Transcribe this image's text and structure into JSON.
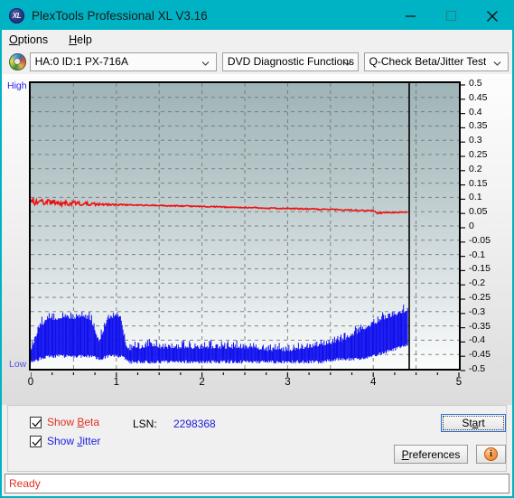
{
  "window": {
    "title": "PlexTools Professional XL V3.16",
    "icon": "XL",
    "app_icon_name": "plextools-logo-icon",
    "controls": {
      "minimize": "minimize-icon",
      "maximize": "maximize-icon",
      "close": "close-icon"
    },
    "titlebar_color": "#00b3c4"
  },
  "menu": {
    "items": [
      {
        "label": "Options",
        "accel": "O"
      },
      {
        "label": "Help",
        "accel": "H"
      }
    ]
  },
  "toolbar": {
    "disc_icon": "disc-icon",
    "drive_select": {
      "value": "HA:0 ID:1  PX-716A",
      "options": [
        "HA:0 ID:1  PX-716A"
      ]
    },
    "function_select": {
      "value": "DVD Diagnostic Functions",
      "options": [
        "DVD Diagnostic Functions"
      ]
    },
    "test_select": {
      "value": "Q-Check Beta/Jitter Test",
      "options": [
        "Q-Check Beta/Jitter Test"
      ]
    }
  },
  "chart_data": {
    "type": "line",
    "title": "Q-Check Beta/Jitter Test",
    "xlabel": "",
    "ylabel": "",
    "xlim": [
      0,
      5
    ],
    "ylim": [
      -0.5,
      0.5
    ],
    "grid": true,
    "legend_position": "bottom-left",
    "x_ticks": [
      "0",
      "1",
      "2",
      "3",
      "4",
      "5"
    ],
    "y_ticks": [
      "0.5",
      "0.45",
      "0.4",
      "0.35",
      "0.3",
      "0.25",
      "0.2",
      "0.15",
      "0.1",
      "0.05",
      "0",
      "-0.05",
      "-0.1",
      "-0.15",
      "-0.2",
      "-0.25",
      "-0.3",
      "-0.35",
      "-0.4",
      "-0.45",
      "-0.5"
    ],
    "axis_annotations": {
      "top_left": "High",
      "bottom_left": "Low"
    },
    "cursor_x": 4.42,
    "series": [
      {
        "name": "Beta",
        "color": "#ee1111",
        "x": [
          0.02,
          0.06,
          0.1,
          0.15,
          0.2,
          0.25,
          0.3,
          0.35,
          0.4,
          0.45,
          0.5,
          0.6,
          0.7,
          0.8,
          0.9,
          1.0,
          1.1,
          1.2,
          1.3,
          1.4,
          1.5,
          1.6,
          1.7,
          1.8,
          1.9,
          2.0,
          2.2,
          2.4,
          2.6,
          2.8,
          3.0,
          3.2,
          3.4,
          3.6,
          3.8,
          4.0,
          4.05,
          4.1,
          4.2,
          4.3,
          4.4
        ],
        "y": [
          0.088,
          0.083,
          0.087,
          0.081,
          0.086,
          0.08,
          0.084,
          0.079,
          0.082,
          0.078,
          0.08,
          0.078,
          0.077,
          0.076,
          0.075,
          0.074,
          0.074,
          0.073,
          0.073,
          0.072,
          0.072,
          0.071,
          0.07,
          0.07,
          0.069,
          0.068,
          0.067,
          0.065,
          0.064,
          0.062,
          0.061,
          0.06,
          0.058,
          0.057,
          0.055,
          0.053,
          0.044,
          0.046,
          0.047,
          0.048,
          0.048
        ],
        "noise_amplitude_start": 0.012,
        "noise_amplitude_end": 0.002
      },
      {
        "name": "Jitter",
        "color": "#1111ee",
        "x": [
          0.0,
          0.05,
          0.1,
          0.2,
          0.3,
          0.4,
          0.5,
          0.6,
          0.7,
          0.8,
          0.9,
          1.0,
          1.05,
          1.1,
          1.15,
          1.2,
          1.3,
          1.4,
          1.5,
          1.6,
          1.7,
          1.8,
          1.9,
          2.0,
          2.1,
          2.2,
          2.4,
          2.6,
          2.8,
          3.0,
          3.2,
          3.4,
          3.6,
          3.8,
          4.0,
          4.1,
          4.2,
          4.3,
          4.4
        ],
        "y_upper": [
          -0.44,
          -0.4,
          -0.36,
          -0.33,
          -0.33,
          -0.32,
          -0.33,
          -0.32,
          -0.33,
          -0.41,
          -0.33,
          -0.32,
          -0.32,
          -0.41,
          -0.44,
          -0.43,
          -0.43,
          -0.42,
          -0.43,
          -0.43,
          -0.43,
          -0.43,
          -0.43,
          -0.43,
          -0.43,
          -0.43,
          -0.43,
          -0.43,
          -0.44,
          -0.44,
          -0.43,
          -0.42,
          -0.41,
          -0.38,
          -0.35,
          -0.33,
          -0.32,
          -0.31,
          -0.3
        ],
        "y_lower": [
          -0.47,
          -0.47,
          -0.46,
          -0.45,
          -0.45,
          -0.45,
          -0.45,
          -0.45,
          -0.45,
          -0.46,
          -0.45,
          -0.45,
          -0.45,
          -0.46,
          -0.47,
          -0.47,
          -0.47,
          -0.47,
          -0.47,
          -0.47,
          -0.47,
          -0.47,
          -0.47,
          -0.47,
          -0.47,
          -0.47,
          -0.47,
          -0.47,
          -0.47,
          -0.47,
          -0.47,
          -0.47,
          -0.46,
          -0.46,
          -0.45,
          -0.44,
          -0.43,
          -0.42,
          -0.41
        ]
      }
    ]
  },
  "controls": {
    "show_beta": {
      "label_pre": "Show ",
      "accel": "B",
      "label_post": "eta",
      "checked": true
    },
    "show_jitter": {
      "label_pre": "Show ",
      "accel": "J",
      "label_post": "itter",
      "checked": true
    },
    "lsn_label": "LSN:",
    "lsn_value": "2298368",
    "start_button": {
      "label_pre": "St",
      "accel": "a",
      "label_post": "rt"
    },
    "preferences_button": {
      "accel": "P",
      "label_post": "references"
    },
    "info_button": {
      "icon": "info-icon",
      "glyph": "i"
    }
  },
  "status": {
    "text": "Ready",
    "color": "#e03020"
  }
}
